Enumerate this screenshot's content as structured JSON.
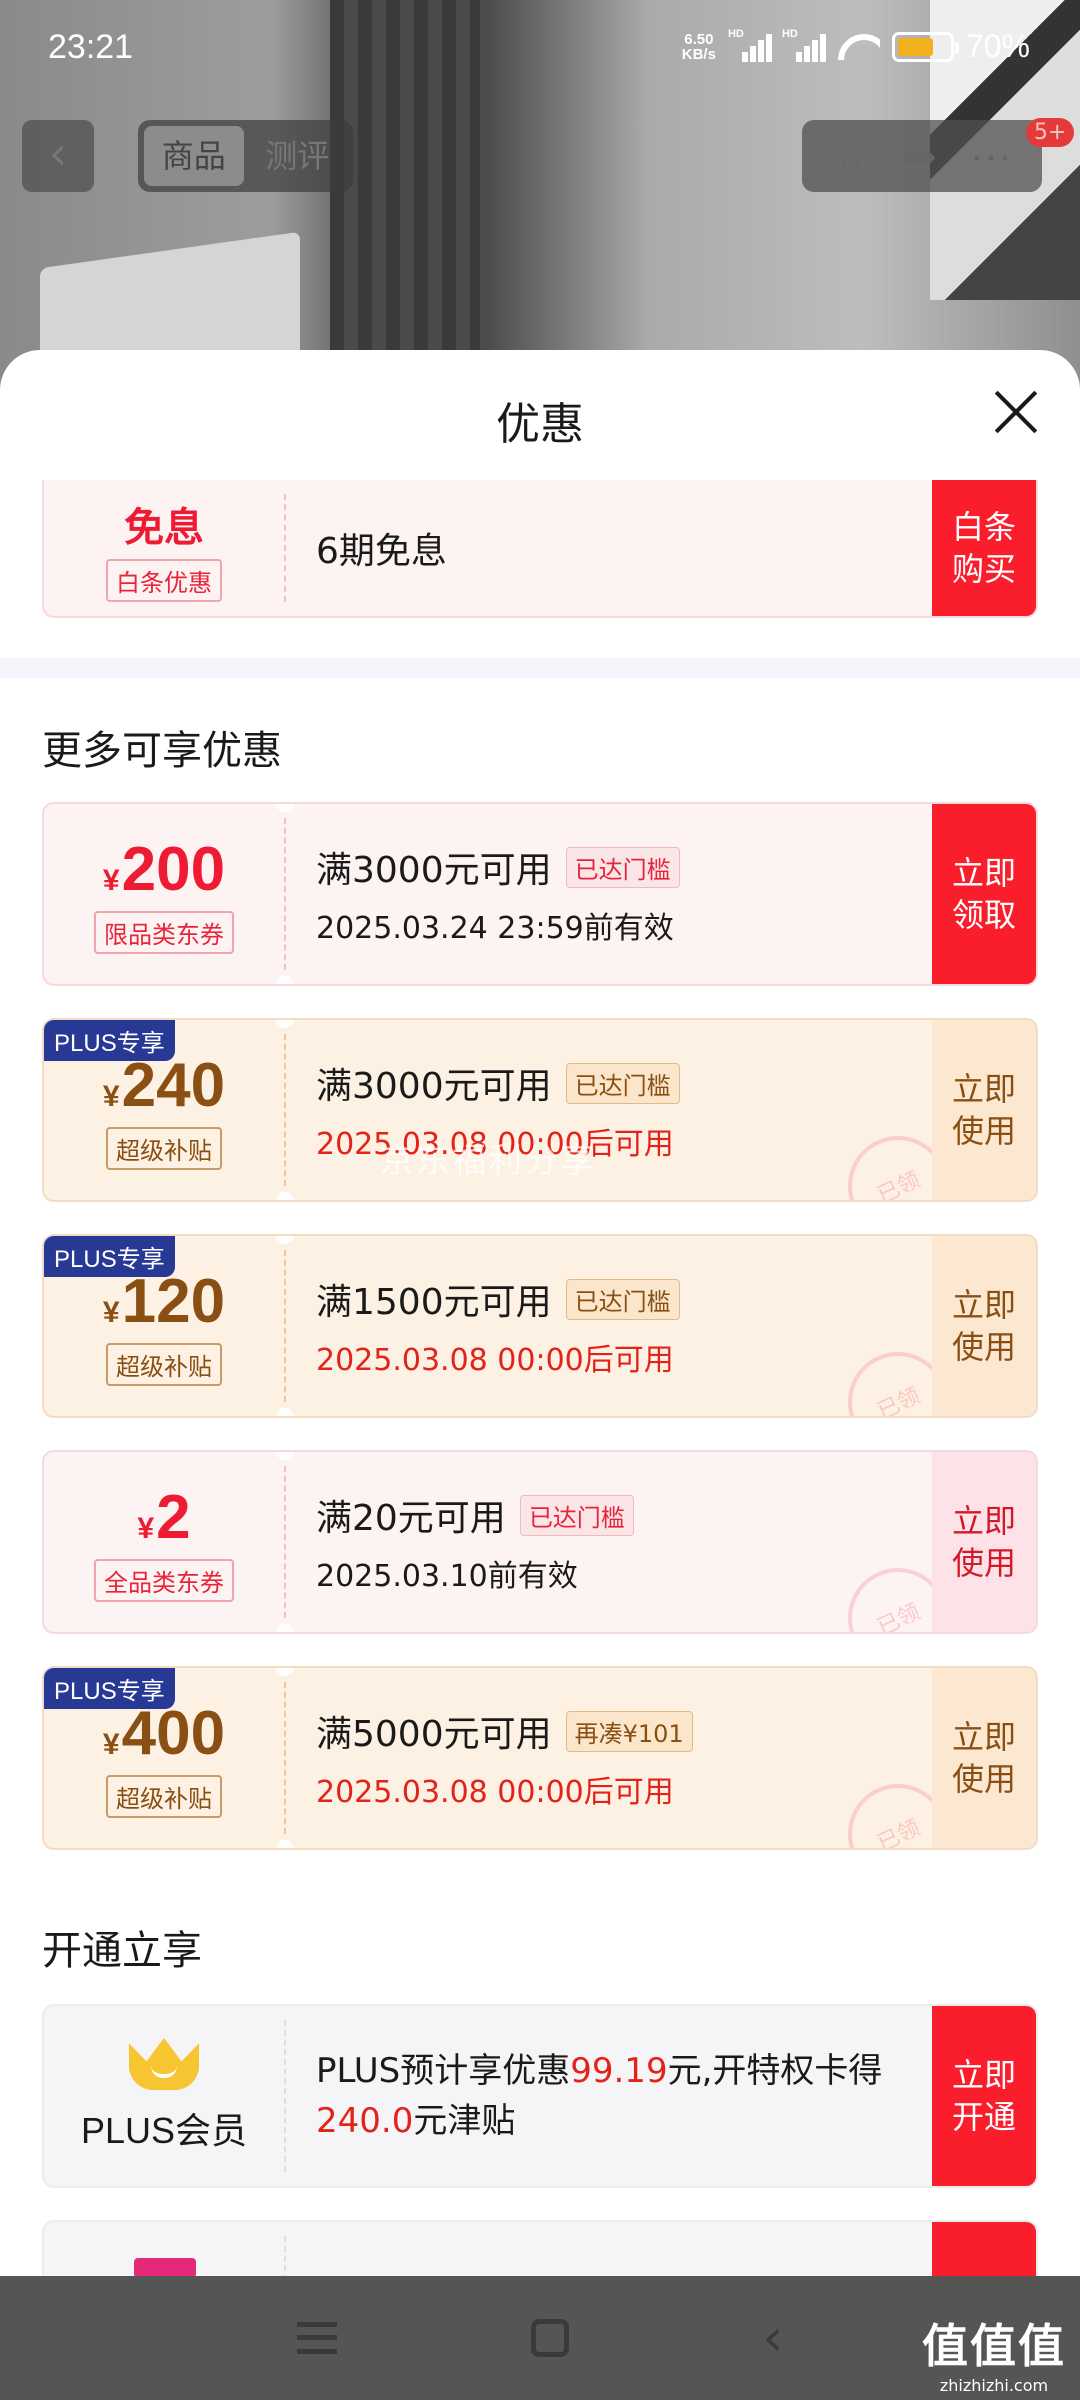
{
  "status_bar": {
    "time": "23:21",
    "net_speed_value": "6.50",
    "net_speed_unit": "KB/s",
    "signal_label_1": "HD",
    "signal_label_2": "HD",
    "battery_percent": "70%",
    "battery_level": 0.7
  },
  "top_nav": {
    "back_icon": "back-icon",
    "tabs": [
      "商品",
      "测评"
    ],
    "badge": "5+"
  },
  "sheet": {
    "title": "优惠"
  },
  "baitiao": {
    "headline": "免息",
    "tag": "白条优惠",
    "desc": "6期免息",
    "action_line1": "白条",
    "action_line2": "购买"
  },
  "more_section": {
    "title": "更多可享优惠",
    "coupons": [
      {
        "yen": "¥",
        "amount": "200",
        "tag": "限品类东券",
        "plus": "",
        "condition": "满3000元可用",
        "reach": "已达门槛",
        "valid": "2025.03.24 23:59前有效",
        "action_line1": "立即",
        "action_line2": "领取"
      },
      {
        "yen": "¥",
        "amount": "240",
        "tag": "超级补贴",
        "plus": "PLUS专享",
        "condition": "满3000元可用",
        "reach": "已达门槛",
        "valid": "2025.03.08 00:00后可用",
        "action_line1": "立即",
        "action_line2": "使用",
        "stamp": "已领"
      },
      {
        "yen": "¥",
        "amount": "120",
        "tag": "超级补贴",
        "plus": "PLUS专享",
        "condition": "满1500元可用",
        "reach": "已达门槛",
        "valid": "2025.03.08 00:00后可用",
        "action_line1": "立即",
        "action_line2": "使用",
        "stamp": "已领"
      },
      {
        "yen": "¥",
        "amount": "2",
        "tag": "全品类东券",
        "plus": "",
        "condition": "满20元可用",
        "reach": "已达门槛",
        "valid": "2025.03.10前有效",
        "action_line1": "立即",
        "action_line2": "使用",
        "stamp": "已领"
      },
      {
        "yen": "¥",
        "amount": "400",
        "tag": "超级补贴",
        "plus": "PLUS专享",
        "condition": "满5000元可用",
        "reach": "再凑¥101",
        "valid": "2025.03.08 00:00后可用",
        "action_line1": "立即",
        "action_line2": "使用",
        "stamp": "已领"
      }
    ]
  },
  "open_section": {
    "title": "开通立享",
    "plus_name": "PLUS会员",
    "desc_part1": "PLUS预计享优惠",
    "desc_hl1": "99.19",
    "desc_part2": "元,开特权卡得",
    "desc_hl2": "240.0",
    "desc_part3": "元津贴",
    "action_line1": "立即",
    "action_line2": "开通"
  },
  "watermark": "京东福利分享",
  "site_logo": {
    "big": "值值值",
    "small": "zhizhizhi.com"
  },
  "colors": {
    "accent_red": "#fa1e2d",
    "plus_blue": "#273895",
    "gold_text": "#8a4f12"
  }
}
